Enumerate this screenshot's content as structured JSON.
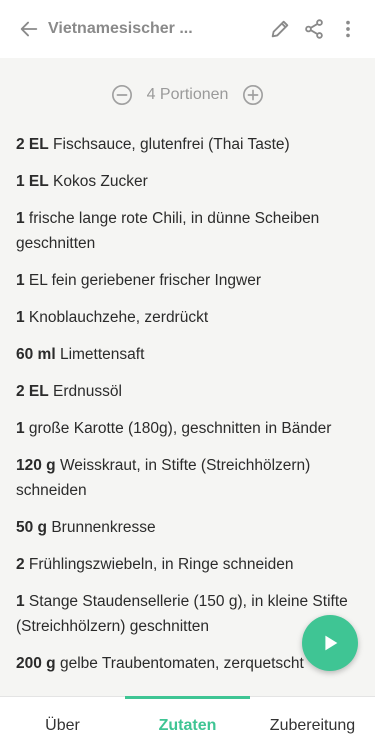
{
  "header": {
    "title": "Vietnamesischer ...",
    "back_icon": "arrow-left-icon",
    "edit_icon": "pencil-icon",
    "share_icon": "share-icon",
    "more_icon": "more-vertical-icon"
  },
  "portions": {
    "label": "4 Portionen",
    "decrease_icon": "minus-circle-icon",
    "increase_icon": "plus-circle-icon"
  },
  "ingredients": [
    {
      "qty": "2 EL",
      "text": " Fischsauce, glutenfrei (Thai Taste)"
    },
    {
      "qty": "1 EL",
      "text": " Kokos Zucker"
    },
    {
      "qty": "1",
      "text": " frische lange rote Chili, in dünne Scheiben geschnitten"
    },
    {
      "qty": "1",
      "text": " EL fein geriebener frischer Ingwer"
    },
    {
      "qty": "1",
      "text": " Knoblauchzehe, zerdrückt"
    },
    {
      "qty": "60 ml",
      "text": " Limettensaft"
    },
    {
      "qty": "2 EL",
      "text": " Erdnussöl"
    },
    {
      "qty": "1",
      "text": " große Karotte (180g), geschnitten in Bänder"
    },
    {
      "qty": "120 g",
      "text": " Weisskraut, in Stifte (Streichhölzern) schneiden"
    },
    {
      "qty": "50 g",
      "text": " Brunnenkresse"
    },
    {
      "qty": "2",
      "text": " Frühlingszwiebeln, in Ringe schneiden"
    },
    {
      "qty": "1",
      "text": " Stange Staudensellerie (150 g), in kleine Stifte (Streichhölzern) geschnitten"
    },
    {
      "qty": "200 g",
      "text": " gelbe Traubentomaten, zerquetscht"
    }
  ],
  "fab": {
    "icon": "play-icon",
    "color": "#3fc594"
  },
  "tabs": [
    {
      "label": "Über",
      "active": false
    },
    {
      "label": "Zutaten",
      "active": true
    },
    {
      "label": "Zubereitung",
      "active": false
    }
  ],
  "colors": {
    "accent": "#3fc594",
    "background": "#f5f5f3"
  }
}
